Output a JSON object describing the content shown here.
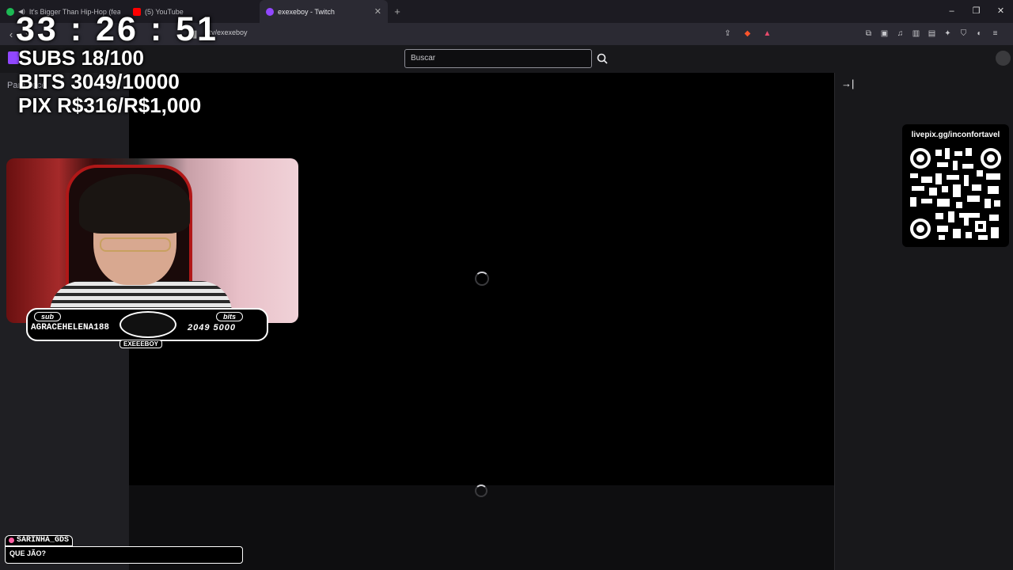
{
  "browser": {
    "tabs": [
      {
        "title": "It's Bigger Than Hip-Hop (feat. Ta",
        "color": "#1db954",
        "active": false
      },
      {
        "title": "(5) YouTube",
        "color": "#ff0000",
        "active": false
      },
      {
        "title": "exexeboy - Twitch",
        "color": "#9147ff",
        "active": true
      }
    ],
    "new_tab": "+",
    "url": ".tv/exexeboy",
    "window_controls": [
      "–",
      "❐",
      "✕"
    ]
  },
  "twitch": {
    "search_placeholder": "Buscar",
    "sidebar_label": "Para você",
    "collapse_icon": "→|"
  },
  "overlay": {
    "timer": "33 : 26 : 51",
    "subs_goal": "SUBS 18/100",
    "bits_goal": "BITS 3049/10000",
    "pix_goal": "PIX R$316/R$1,000",
    "last_sub_tag": "sub",
    "last_sub_name": "AGRACEHELENA188",
    "last_bits_tag": "bits",
    "last_bits_value": "2049 5000",
    "logo_caption": "EXEEEBOY",
    "qr_url": "livepix.gg/inconfortavel",
    "chat_user": "SARINHA_GDS",
    "chat_message": "QUE JÃO?"
  }
}
